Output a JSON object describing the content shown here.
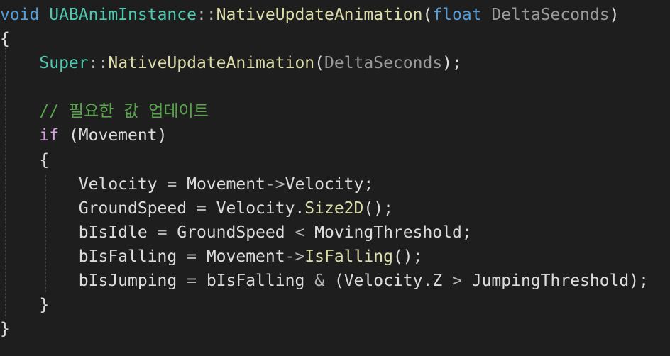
{
  "editor": {
    "lines": [
      {
        "tokens": [
          {
            "text": "void",
            "style": "kw"
          },
          {
            "text": " ",
            "style": "txt"
          },
          {
            "text": "UABAnimInstance",
            "style": "cls"
          },
          {
            "text": "::",
            "style": "op"
          },
          {
            "text": "NativeUpdateAnimation",
            "style": "fn"
          },
          {
            "text": "(",
            "style": "txt"
          },
          {
            "text": "float",
            "style": "kw"
          },
          {
            "text": " ",
            "style": "txt"
          },
          {
            "text": "DeltaSeconds",
            "style": "param"
          },
          {
            "text": ")",
            "style": "txt"
          }
        ]
      },
      {
        "tokens": [
          {
            "text": "{",
            "style": "txt"
          }
        ]
      },
      {
        "tokens": [
          {
            "text": "    ",
            "style": "txt"
          },
          {
            "text": "Super",
            "style": "cls"
          },
          {
            "text": "::",
            "style": "op"
          },
          {
            "text": "NativeUpdateAnimation",
            "style": "fn"
          },
          {
            "text": "(",
            "style": "txt"
          },
          {
            "text": "DeltaSeconds",
            "style": "param"
          },
          {
            "text": ");",
            "style": "txt"
          }
        ]
      },
      {
        "tokens": []
      },
      {
        "tokens": [
          {
            "text": "    ",
            "style": "txt"
          },
          {
            "text": "// 필요한 값 업데이트",
            "style": "cm"
          }
        ]
      },
      {
        "tokens": [
          {
            "text": "    ",
            "style": "txt"
          },
          {
            "text": "if",
            "style": "ctrl"
          },
          {
            "text": " (Movement)",
            "style": "txt"
          }
        ]
      },
      {
        "tokens": [
          {
            "text": "    {",
            "style": "txt"
          }
        ]
      },
      {
        "tokens": [
          {
            "text": "        Velocity ",
            "style": "txt"
          },
          {
            "text": "=",
            "style": "op"
          },
          {
            "text": " Movement",
            "style": "txt"
          },
          {
            "text": "->",
            "style": "op"
          },
          {
            "text": "Velocity;",
            "style": "txt"
          }
        ]
      },
      {
        "tokens": [
          {
            "text": "        GroundSpeed ",
            "style": "txt"
          },
          {
            "text": "=",
            "style": "op"
          },
          {
            "text": " Velocity.",
            "style": "txt"
          },
          {
            "text": "Size2D",
            "style": "fn"
          },
          {
            "text": "();",
            "style": "txt"
          }
        ]
      },
      {
        "tokens": [
          {
            "text": "        bIsIdle ",
            "style": "txt"
          },
          {
            "text": "=",
            "style": "op"
          },
          {
            "text": " GroundSpeed ",
            "style": "txt"
          },
          {
            "text": "<",
            "style": "op"
          },
          {
            "text": " MovingThreshold;",
            "style": "txt"
          }
        ]
      },
      {
        "tokens": [
          {
            "text": "        bIsFalling ",
            "style": "txt"
          },
          {
            "text": "=",
            "style": "op"
          },
          {
            "text": " Movement",
            "style": "txt"
          },
          {
            "text": "->",
            "style": "op"
          },
          {
            "text": "IsFalling",
            "style": "fn"
          },
          {
            "text": "();",
            "style": "txt"
          }
        ]
      },
      {
        "tokens": [
          {
            "text": "        bIsJumping ",
            "style": "txt"
          },
          {
            "text": "=",
            "style": "op"
          },
          {
            "text": " bIsFalling ",
            "style": "txt"
          },
          {
            "text": "&",
            "style": "op"
          },
          {
            "text": " (Velocity.Z ",
            "style": "txt"
          },
          {
            "text": ">",
            "style": "op"
          },
          {
            "text": " JumpingThreshold);",
            "style": "txt"
          }
        ]
      },
      {
        "tokens": [
          {
            "text": "    }",
            "style": "txt"
          }
        ]
      },
      {
        "tokens": [
          {
            "text": "}",
            "style": "txt"
          }
        ]
      }
    ]
  }
}
